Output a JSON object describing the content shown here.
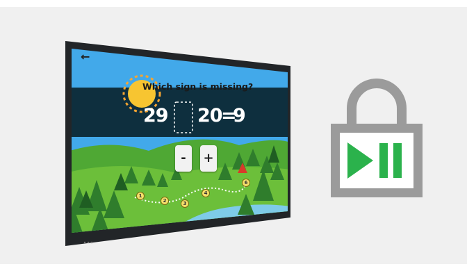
{
  "screen": {
    "back_icon": "arrow-left-icon",
    "question": "Which sign is missing?",
    "equation": {
      "left": "29",
      "right": "20",
      "equals": "=",
      "result": "9"
    },
    "buttons": {
      "minus": "-",
      "plus": "+"
    },
    "path_nodes": [
      "1",
      "2",
      "3",
      "4",
      "6"
    ]
  },
  "lock_icon": {
    "name": "play-pause-lock-icon",
    "color": "#9b9b9b",
    "play_color": "#2bb24c"
  },
  "colors": {
    "sky": "#42a9ea",
    "band": "#0e2f3e",
    "grass": "#6cbf3a",
    "river": "#7ecbe8"
  }
}
